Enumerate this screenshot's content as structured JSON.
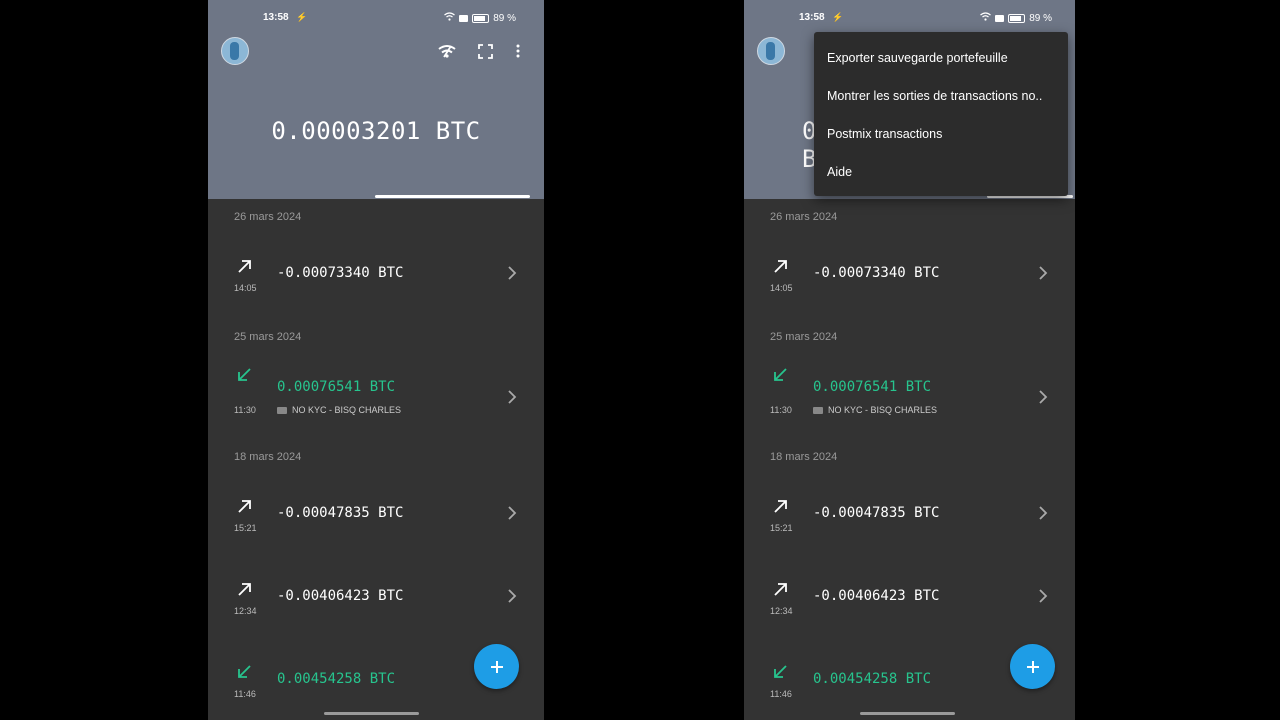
{
  "status": {
    "time": "13:58",
    "battery": "89 %"
  },
  "wallet": {
    "balance": "0.00003201 BTC"
  },
  "dates": [
    "26 mars 2024",
    "25 mars 2024",
    "18 mars 2024"
  ],
  "transactions": [
    {
      "time": "14:05",
      "amount": "-0.00073340 BTC",
      "direction": "out",
      "label": ""
    },
    {
      "time": "11:30",
      "amount": "0.00076541 BTC",
      "direction": "in",
      "label": "NO KYC - BISQ CHARLES"
    },
    {
      "time": "15:21",
      "amount": "-0.00047835 BTC",
      "direction": "out",
      "label": ""
    },
    {
      "time": "12:34",
      "amount": "-0.00406423 BTC",
      "direction": "out",
      "label": ""
    },
    {
      "time": "11:46",
      "amount": "0.00454258 BTC",
      "direction": "in",
      "label": ""
    }
  ],
  "menu": {
    "items": [
      "Exporter sauvegarde portefeuille",
      "Montrer les sorties de transactions no..",
      "Postmix transactions",
      "Aide"
    ]
  },
  "icons": {
    "network": "network-icon",
    "fullscreen": "fullscreen-icon",
    "more": "more-vert-icon",
    "add": "plus-icon"
  },
  "colors": {
    "incoming": "#27c48e",
    "header": "#6e7686",
    "fab": "#1e9de6",
    "background": "#333333"
  }
}
